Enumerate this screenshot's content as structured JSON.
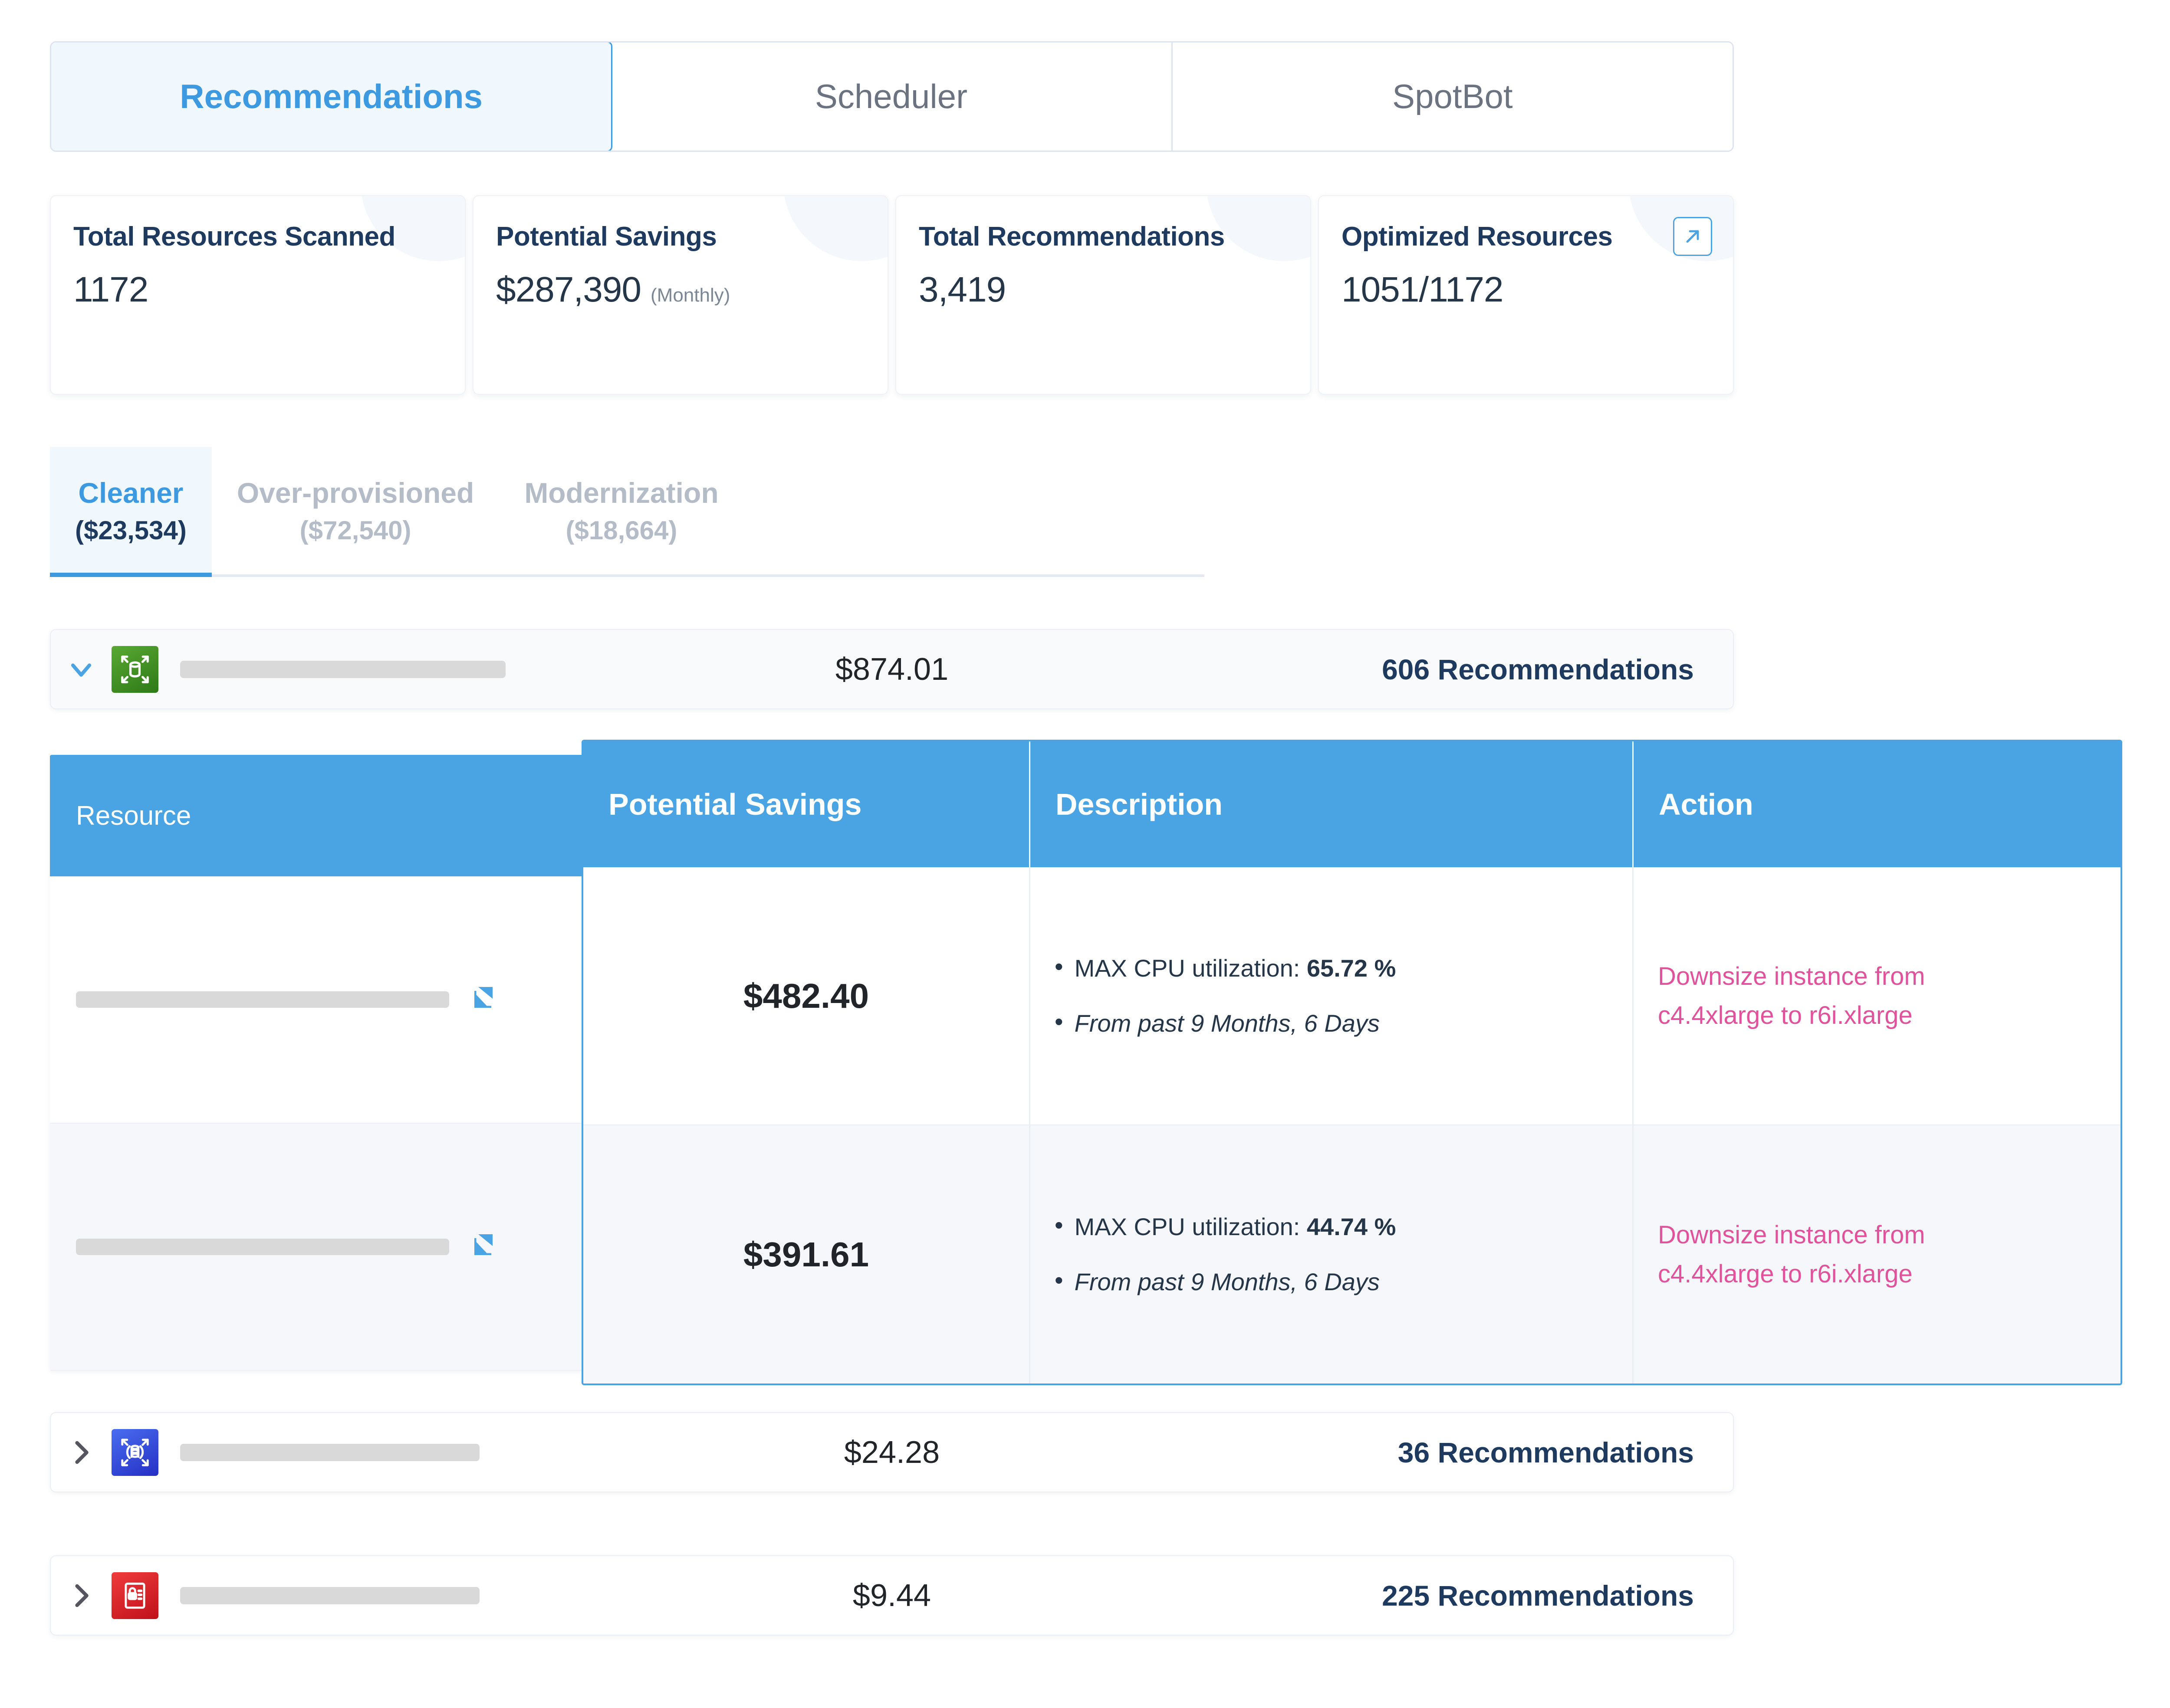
{
  "tabs": [
    {
      "label": "Recommendations",
      "active": true
    },
    {
      "label": "Scheduler",
      "active": false
    },
    {
      "label": "SpotBot",
      "active": false
    }
  ],
  "kpis": [
    {
      "title": "Total Resources Scanned",
      "value": "1172",
      "suffix": ""
    },
    {
      "title": "Potential Savings",
      "value": "$287,390",
      "suffix": "(Monthly)"
    },
    {
      "title": "Total Recommendations",
      "value": "3,419",
      "suffix": ""
    },
    {
      "title": "Optimized Resources",
      "value": "1051/1172",
      "suffix": "",
      "has_external_link": true
    }
  ],
  "subtabs": [
    {
      "label": "Cleaner",
      "amount": "($23,534)",
      "active": true
    },
    {
      "label": "Over-provisioned",
      "amount": "($72,540)",
      "active": false
    },
    {
      "label": "Modernization",
      "amount": "($18,664)",
      "active": false
    }
  ],
  "groups": [
    {
      "amount": "$874.01",
      "count": "606 Recommendations",
      "icon": "autoscaling-resize-icon",
      "icon_color": "#2d7a18",
      "expanded": true
    },
    {
      "amount": "$24.28",
      "count": "36 Recommendations",
      "icon": "database-resize-icon",
      "icon_color": "#2530c4",
      "expanded": false
    },
    {
      "amount": "$9.44",
      "count": "225 Recommendations",
      "icon": "secrets-lock-icon",
      "icon_color": "#c0101a",
      "expanded": false
    }
  ],
  "table": {
    "columns": [
      "Resource",
      "Potential Savings",
      "Description",
      "Action"
    ],
    "rows": [
      {
        "savings": "$482.40",
        "desc_metric_label": "MAX CPU utilization:",
        "desc_metric_value": "65.72 %",
        "desc_period": "From past 9 Months, 6 Days",
        "action_line1": "Downsize instance from",
        "action_line2": "c4.4xlarge to r6i.xlarge"
      },
      {
        "savings": "$391.61",
        "desc_metric_label": "MAX CPU utilization:",
        "desc_metric_value": "44.74 %",
        "desc_period": "From past 9 Months, 6 Days",
        "action_line1": "Downsize instance from",
        "action_line2": "c4.4xlarge to r6i.xlarge"
      }
    ]
  },
  "colors": {
    "accent_blue": "#4aa3e3",
    "header_navy": "#1e3a5f",
    "action_pink": "#e0529c",
    "muted_grey": "#b4bcc8"
  }
}
